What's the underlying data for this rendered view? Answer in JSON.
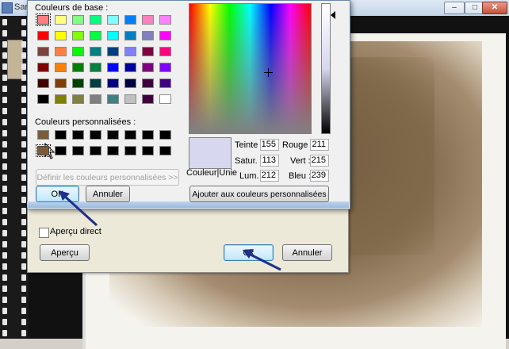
{
  "background_window": {
    "title": "Sar"
  },
  "effect_dialog": {
    "live_preview_label": "Aperçu direct",
    "live_preview_checked": false,
    "preview_button": "Aperçu",
    "ok_button": "Ok",
    "cancel_button": "Annuler"
  },
  "color_dialog": {
    "basic_colors_label": "Couleurs de base :",
    "custom_colors_label": "Couleurs personnalisées :",
    "define_custom_button": "Définir les couleurs personnalisées >>",
    "ok_button": "OK",
    "cancel_button": "Annuler",
    "color_solid_label": "Couleur|Unie",
    "add_custom_button": "Ajouter aux couleurs personnalisées",
    "fields": {
      "hue_label": "Teinte :",
      "hue": "155",
      "sat_label": "Satur. :",
      "sat": "113",
      "lum_label": "Lum. :",
      "lum": "212",
      "red_label": "Rouge :",
      "red": "211",
      "green_label": "Vert :",
      "green": "215",
      "blue_label": "Bleu :",
      "blue": "239"
    },
    "basic_colors": [
      "#ff8080",
      "#ffff80",
      "#80ff80",
      "#00ff80",
      "#80ffff",
      "#0080ff",
      "#ff80c0",
      "#ff80ff",
      "#ff0000",
      "#ffff00",
      "#80ff00",
      "#00ff40",
      "#00ffff",
      "#0080c0",
      "#8080c0",
      "#ff00ff",
      "#804040",
      "#ff8040",
      "#00ff00",
      "#008080",
      "#004080",
      "#8080ff",
      "#800040",
      "#ff0080",
      "#800000",
      "#ff8000",
      "#008000",
      "#008040",
      "#0000ff",
      "#0000a0",
      "#800080",
      "#8000ff",
      "#400000",
      "#804000",
      "#004000",
      "#004040",
      "#000080",
      "#000040",
      "#400040",
      "#400080",
      "#000000",
      "#808000",
      "#808040",
      "#808080",
      "#408080",
      "#c0c0c0",
      "#400040",
      "#ffffff"
    ],
    "custom_colors": [
      "#7a5c3a",
      "#000000",
      "#000000",
      "#000000",
      "#000000",
      "#000000",
      "#000000",
      "#000000",
      "#7a5c3a",
      "#000000",
      "#000000",
      "#000000",
      "#000000",
      "#000000",
      "#000000",
      "#000000"
    ],
    "current_color": "#d7d7ef"
  },
  "colors": {
    "arrow": "#1f2f8a",
    "dialog_bg": "#f0f0f0"
  }
}
